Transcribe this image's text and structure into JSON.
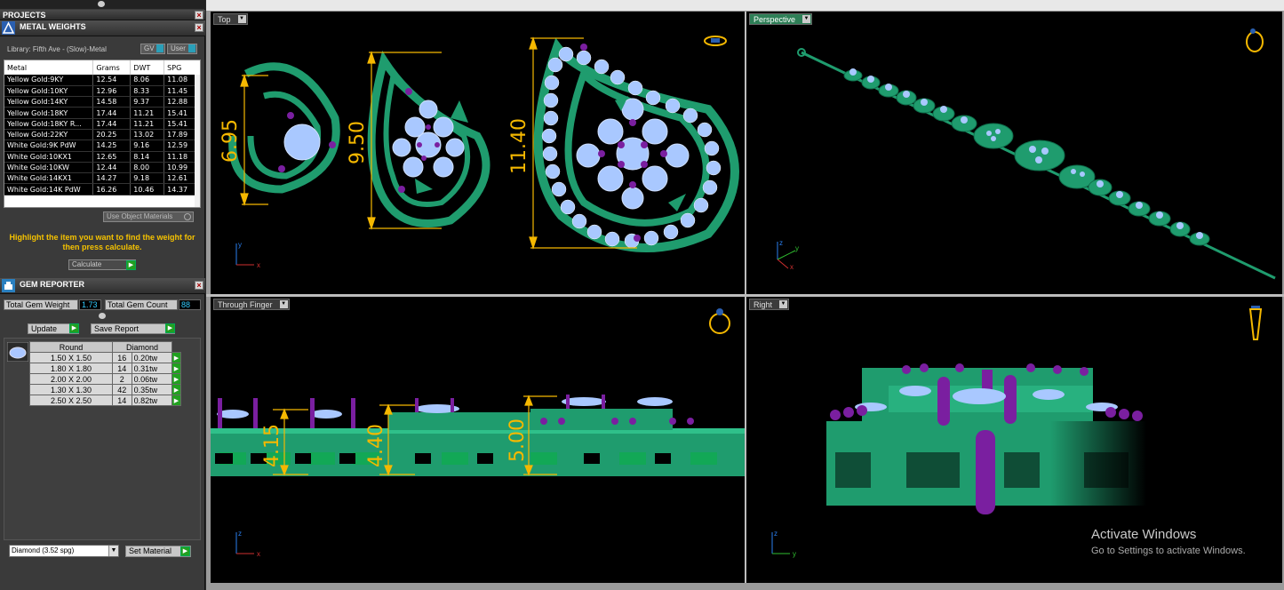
{
  "left_panel": {
    "projects_title": "PROJECTS",
    "metal_weights_title": "METAL WEIGHTS",
    "library_label": "Library: Fifth Ave - (Slow)-Metal",
    "gv_label": "GV",
    "user_label": "User",
    "metal_table": {
      "headers": [
        "Metal",
        "Grams",
        "DWT",
        "SPG"
      ],
      "rows": [
        [
          "Yellow Gold:9KY",
          "12.54",
          "8.06",
          "11.08"
        ],
        [
          "Yellow Gold:10KY",
          "12.96",
          "8.33",
          "11.45"
        ],
        [
          "Yellow Gold:14KY",
          "14.58",
          "9.37",
          "12.88"
        ],
        [
          "Yellow Gold:18KY",
          "17.44",
          "11.21",
          "15.41"
        ],
        [
          "Yellow Gold:18KY R...",
          "17.44",
          "11.21",
          "15.41"
        ],
        [
          "Yellow Gold:22KY",
          "20.25",
          "13.02",
          "17.89"
        ],
        [
          "White Gold:9K PdW",
          "14.25",
          "9.16",
          "12.59"
        ],
        [
          "White Gold:10KX1",
          "12.65",
          "8.14",
          "11.18"
        ],
        [
          "White Gold:10KW",
          "12.44",
          "8.00",
          "10.99"
        ],
        [
          "White Gold:14KX1",
          "14.27",
          "9.18",
          "12.61"
        ],
        [
          "White Gold:14K PdW",
          "16.26",
          "10.46",
          "14.37"
        ]
      ]
    },
    "use_object_materials": "Use Object Materials",
    "hint": "Highlight the item you want to find the weight for then press calculate.",
    "calculate_label": "Calculate",
    "gem_reporter_title": "GEM REPORTER",
    "total_gem_weight_label": "Total Gem Weight",
    "total_gem_weight_value": "1.73",
    "total_gem_count_label": "Total Gem Count",
    "total_gem_count_value": "88",
    "update_label": "Update",
    "save_report_label": "Save Report",
    "gem_table": {
      "headers": [
        "Round",
        "Diamond"
      ],
      "rows": [
        [
          "1.50 X 1.50",
          "16",
          "0.20tw"
        ],
        [
          "1.80 X 1.80",
          "14",
          "0.31tw"
        ],
        [
          "2.00 X 2.00",
          "2",
          "0.06tw"
        ],
        [
          "1.30 X 1.30",
          "42",
          "0.35tw"
        ],
        [
          "2.50 X 2.50",
          "14",
          "0.82tw"
        ]
      ]
    },
    "material_select": "Diamond    (3.52 spg)",
    "set_material_label": "Set Material"
  },
  "viewports": {
    "top": {
      "label": "Top",
      "dims": [
        "6.95",
        "9.50",
        "11.40"
      ]
    },
    "perspective": {
      "label": "Perspective"
    },
    "through_finger": {
      "label": "Through Finger",
      "dims": [
        "4.15",
        "4.40",
        "5.00"
      ]
    },
    "right": {
      "label": "Right"
    }
  },
  "watermark": {
    "line1": "Activate Windows",
    "line2": "Go to Settings to activate Windows."
  },
  "colors": {
    "metal": "#1f9c6e",
    "gem": "#a9c8ff",
    "prong": "#7a1fa0",
    "dimension": "#f5b800"
  }
}
